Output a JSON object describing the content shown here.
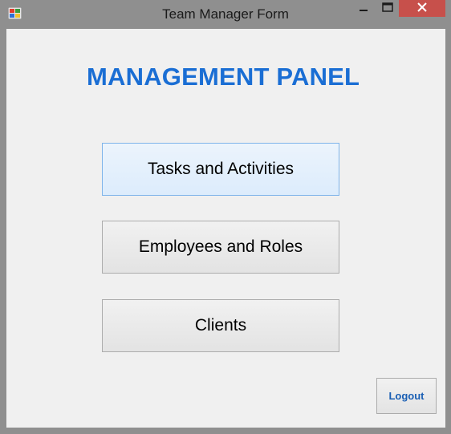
{
  "window": {
    "title": "Team Manager Form"
  },
  "panel": {
    "heading": "MANAGEMENT PANEL",
    "heading_color": "#1a6ed4"
  },
  "buttons": {
    "tasks": "Tasks and Activities",
    "employees": "Employees and Roles",
    "clients": "Clients",
    "logout": "Logout"
  },
  "icons": {
    "app": "app-icon",
    "minimize": "minimize-icon",
    "maximize": "maximize-icon",
    "close": "close-icon"
  },
  "colors": {
    "close_button": "#c7504b",
    "focus_border": "#7eb4ea",
    "logout_text": "#1a5fb4"
  }
}
